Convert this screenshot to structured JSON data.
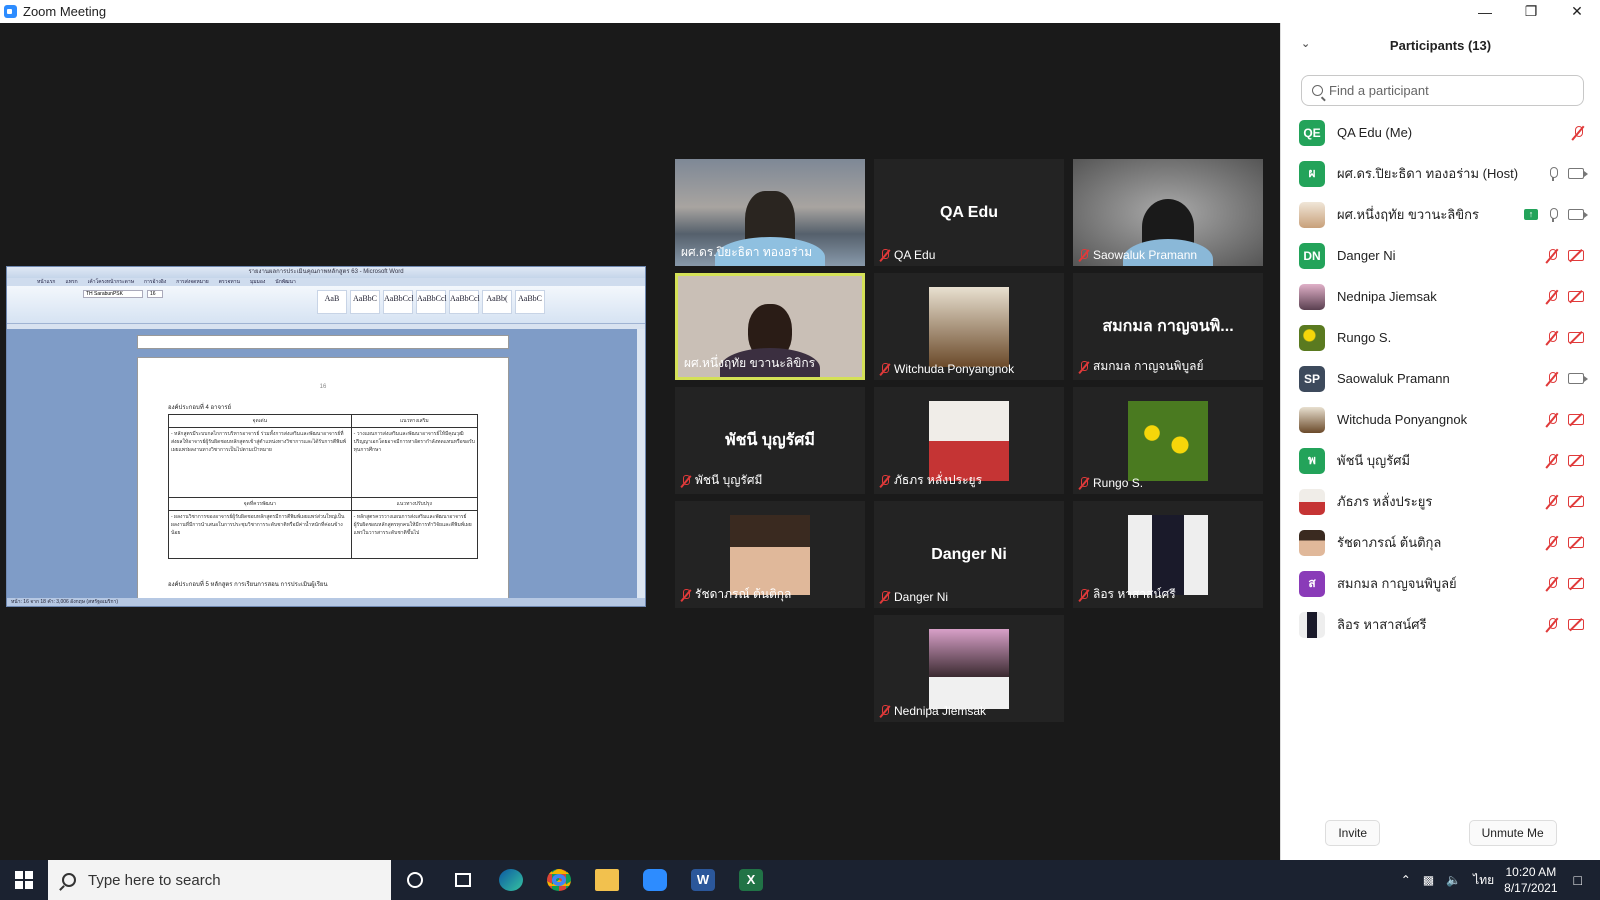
{
  "window": {
    "title": "Zoom Meeting"
  },
  "share": {
    "doc_title": "รายงานผลการประเมินคุณภาพหลักสูตร 63 - Microsoft Word",
    "ribbon_tabs": [
      "หน้าแรก",
      "แทรก",
      "เค้าโครงหน้ากระดาษ",
      "การอ้างอิง",
      "การส่งจดหมาย",
      "ตรวจทาน",
      "มุมมอง",
      "นักพัฒนา"
    ],
    "font_name": "TH SarabunPSK",
    "font_size": "16",
    "styles": [
      "AaB",
      "AaBbC",
      "AaBbCcl",
      "AaBbCcl",
      "AaBbCcl",
      "AaBb(",
      "AaBbC"
    ],
    "page_number": "16",
    "section_heading": "องค์ประกอบที่ 4 อาจารย์",
    "table": {
      "h1": "จุดเด่น",
      "h2": "แนวทางเสริม",
      "r1c1": "- หลักสูตรมีระบบกลไกการบริหารอาจารย์ ร่วมทั้งการส่งเสริมและพัฒนาอาจารย์ที่ส่งผลให้อาจารย์ผู้รับผิดชอบหลักสูตรเข้าสู่ตำแหน่งทางวิชาการและได้รับการตีพิมพ์เผยแพร่ผลงานทางวิชาการเป็นไปตามเป้าหมาย",
      "r1c2": "- วางแผนการส่งเสริมและพัฒนาอาจารย์ให้มีคุณวุฒิปริญญาเอกโดยอาจมีการหาอัตรากำลังทดแทนหรือขอรับทุนการศึกษา",
      "h3": "จุดที่ควรพัฒนา",
      "h4": "แนวทางปรับปรุง",
      "r2c1": "- ผลงานวิชาการของอาจารย์ผู้รับผิดชอบหลักสูตรมีการตีพิมพ์เผยแพร่ส่วนใหญ่เป็นผลงานที่มีการนำเสนอในการประชุมวิชาการระดับชาติหรือมีค่าน้ำหนักที่ค่อนข้างน้อย",
      "r2c2": "- หลักสูตรควรวางแผนการส่งเสริมและพัฒนาอาจารย์ผู้รับผิดชอบหลักสูตรทุกคนให้มีการทำวิจัยและตีพิมพ์เผยแพร่ในวารสารระดับชาติขึ้นไป"
    },
    "footer_heading": "องค์ประกอบที่ 5 หลักสูตร การเรียนการสอน การประเมินผู้เรียน",
    "status": "หน้า: 16 จาก 18   คำ: 3,006   อังกฤษ (สหรัฐอเมริกา)"
  },
  "tiles": [
    {
      "name": "ผศ.ดร.ปิยะธิดา ทองอร่าม",
      "muted": false
    },
    {
      "name": "QA Edu",
      "big": "QA Edu",
      "muted": true
    },
    {
      "name": "Saowaluk Pramann",
      "muted": true
    },
    {
      "name": "ผศ.หนึ่งฤทัย ขวานะลิขิกร",
      "muted": false
    },
    {
      "name": "Witchuda Ponyangnok",
      "muted": true
    },
    {
      "name": "สมกมล กาญจนพิบูลย์",
      "big": "สมกมล กาญจนพิ...",
      "muted": true
    },
    {
      "name": "พัชนี บุญรัศมี",
      "big": "พัชนี บุญรัศมี",
      "muted": true
    },
    {
      "name": "ภัธภร หลั่งประยูร",
      "muted": true
    },
    {
      "name": "Rungo S.",
      "muted": true
    },
    {
      "name": "รัชดาภรณ์ ต้นติกุล",
      "muted": true
    },
    {
      "name": "Danger Ni",
      "big": "Danger Ni",
      "muted": true
    },
    {
      "name": "ลิอร หาสาสน์ศรี",
      "muted": true
    },
    {
      "name": "Nednipa Jiemsak",
      "muted": true
    }
  ],
  "participants": {
    "title": "Participants (13)",
    "search_placeholder": "Find a participant",
    "list": [
      {
        "initials": "QE",
        "name": "QA Edu (Me)",
        "color": "#23a35a"
      },
      {
        "initials": "ผ",
        "name": "ผศ.ดร.ปิยะธิดา ทองอร่าม (Host)",
        "color": "#23a35a"
      },
      {
        "initials": "",
        "name": "ผศ.หนึ่งฤทัย ขวานะลิขิกร",
        "color": "#d9c1a3"
      },
      {
        "initials": "DN",
        "name": "Danger Ni",
        "color": "#23a35a"
      },
      {
        "initials": "",
        "name": "Nednipa Jiemsak",
        "color": "#b98a9a"
      },
      {
        "initials": "",
        "name": "Rungo S.",
        "color": "#8a9a20"
      },
      {
        "initials": "SP",
        "name": "Saowaluk Pramann",
        "color": "#3d4a5c"
      },
      {
        "initials": "",
        "name": "Witchuda Ponyangnok",
        "color": "#7a5a4a"
      },
      {
        "initials": "พ",
        "name": "พัชนี บุญรัศมี",
        "color": "#23a35a"
      },
      {
        "initials": "",
        "name": "ภัธภร หลั่งประยูร",
        "color": "#c08080"
      },
      {
        "initials": "",
        "name": "รัชดาภรณ์ ต้นติกุล",
        "color": "#a87a6a"
      },
      {
        "initials": "ส",
        "name": "สมกมล กาญจนพิบูลย์",
        "color": "#8a3bb8"
      },
      {
        "initials": "",
        "name": "ลิอร หาสาสน์ศรี",
        "color": "#3a3a4a"
      }
    ],
    "invite_label": "Invite",
    "unmute_label": "Unmute Me"
  },
  "taskbar": {
    "search_text": "Type here to search",
    "lang": "ไทย",
    "time": "10:20 AM",
    "date": "8/17/2021"
  },
  "colors": {
    "accent": "#2d8cff",
    "muted": "#e03a3a",
    "active_speaker": "#d4e157"
  }
}
